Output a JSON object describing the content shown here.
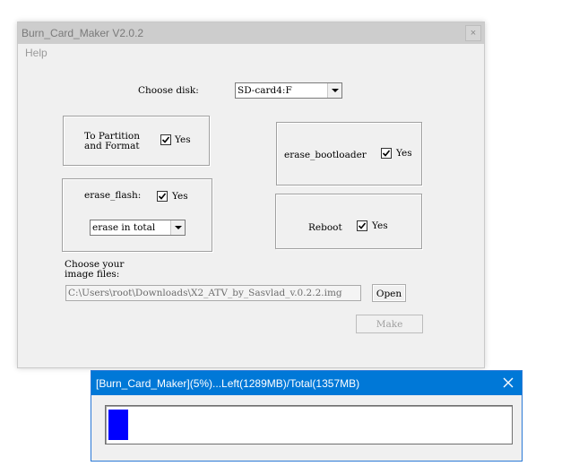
{
  "main_window": {
    "title": "Burn_Card_Maker V2.0.2",
    "close_glyph": "×",
    "menu": {
      "help": "Help"
    },
    "choose_disk": {
      "label": "Choose disk:",
      "selected": "SD-card4:F"
    },
    "partition_group": {
      "label_line1": "To Partition",
      "label_line2": "and Format",
      "checked": true,
      "yes_label": "Yes"
    },
    "erase_bootloader": {
      "label": "erase_bootloader",
      "checked": true,
      "yes_label": "Yes"
    },
    "erase_flash": {
      "label": "erase_flash:",
      "checked": true,
      "yes_label": "Yes",
      "mode_selected": "erase in total"
    },
    "reboot": {
      "label": "Reboot",
      "checked": true,
      "yes_label": "Yes"
    },
    "image": {
      "label_line1": "Choose your",
      "label_line2": "image files:",
      "path": "C:\\Users\\root\\Downloads\\X2_ATV_by_Sasvlad_v.0.2.2.img",
      "open_label": "Open"
    },
    "make_label": "Make"
  },
  "progress_window": {
    "title": "[Burn_Card_Maker](5%)...Left(1289MB)/Total(1357MB)",
    "progress_fraction": 0.05
  },
  "colors": {
    "progress_title_bg": "#0078d7",
    "progress_fill": "#0000ff",
    "main_titlebar": "#cdcdcd"
  }
}
